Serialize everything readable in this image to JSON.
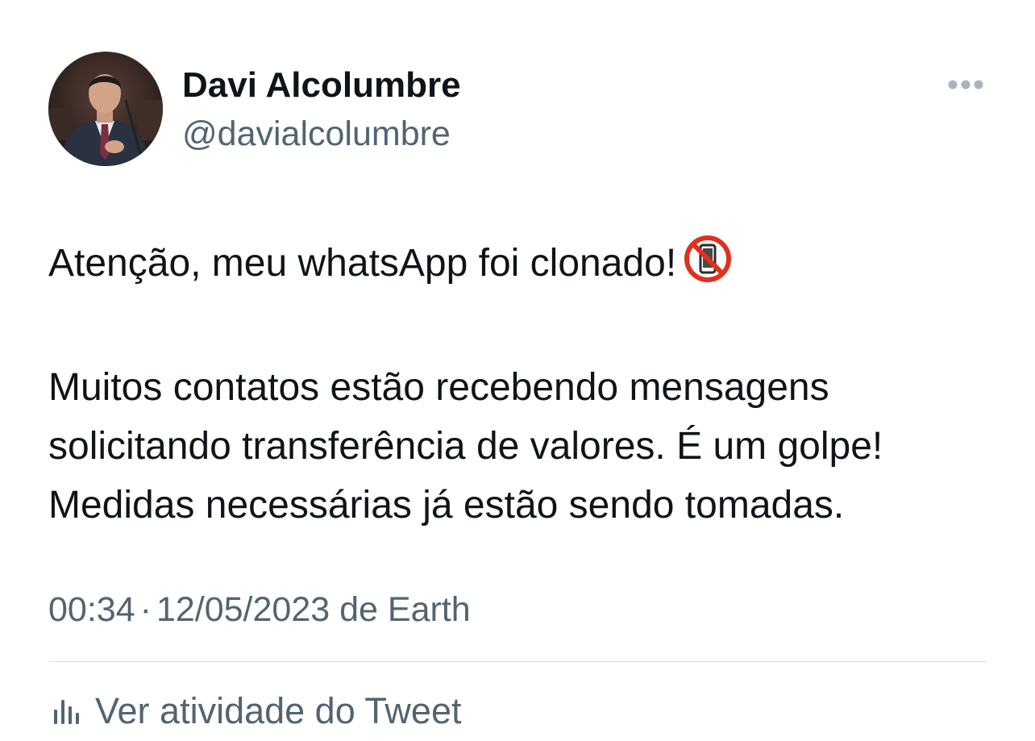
{
  "author": {
    "display_name": "Davi Alcolumbre",
    "handle": "@davialcolumbre"
  },
  "more_icon": "more-horizontal-icon",
  "tweet": {
    "line1": "Atenção, meu whatsApp foi clonado!",
    "line1_emoji": "no-mobile-phones-icon",
    "line2": "Muitos contatos estão recebendo mensagens",
    "line3": "solicitando transferência de valores. É um golpe!",
    "line4": "Medidas necessárias já estão sendo tomadas."
  },
  "meta": {
    "time": "00:34",
    "separator": "·",
    "date": "12/05/2023",
    "source": "de Earth"
  },
  "activity": {
    "icon": "analytics-bars-icon",
    "label": "Ver atividade do Tweet"
  },
  "colors": {
    "text_primary": "#0f1419",
    "text_secondary": "#536471",
    "divider": "#d8dde1",
    "no_phone_red": "#e0301e"
  }
}
